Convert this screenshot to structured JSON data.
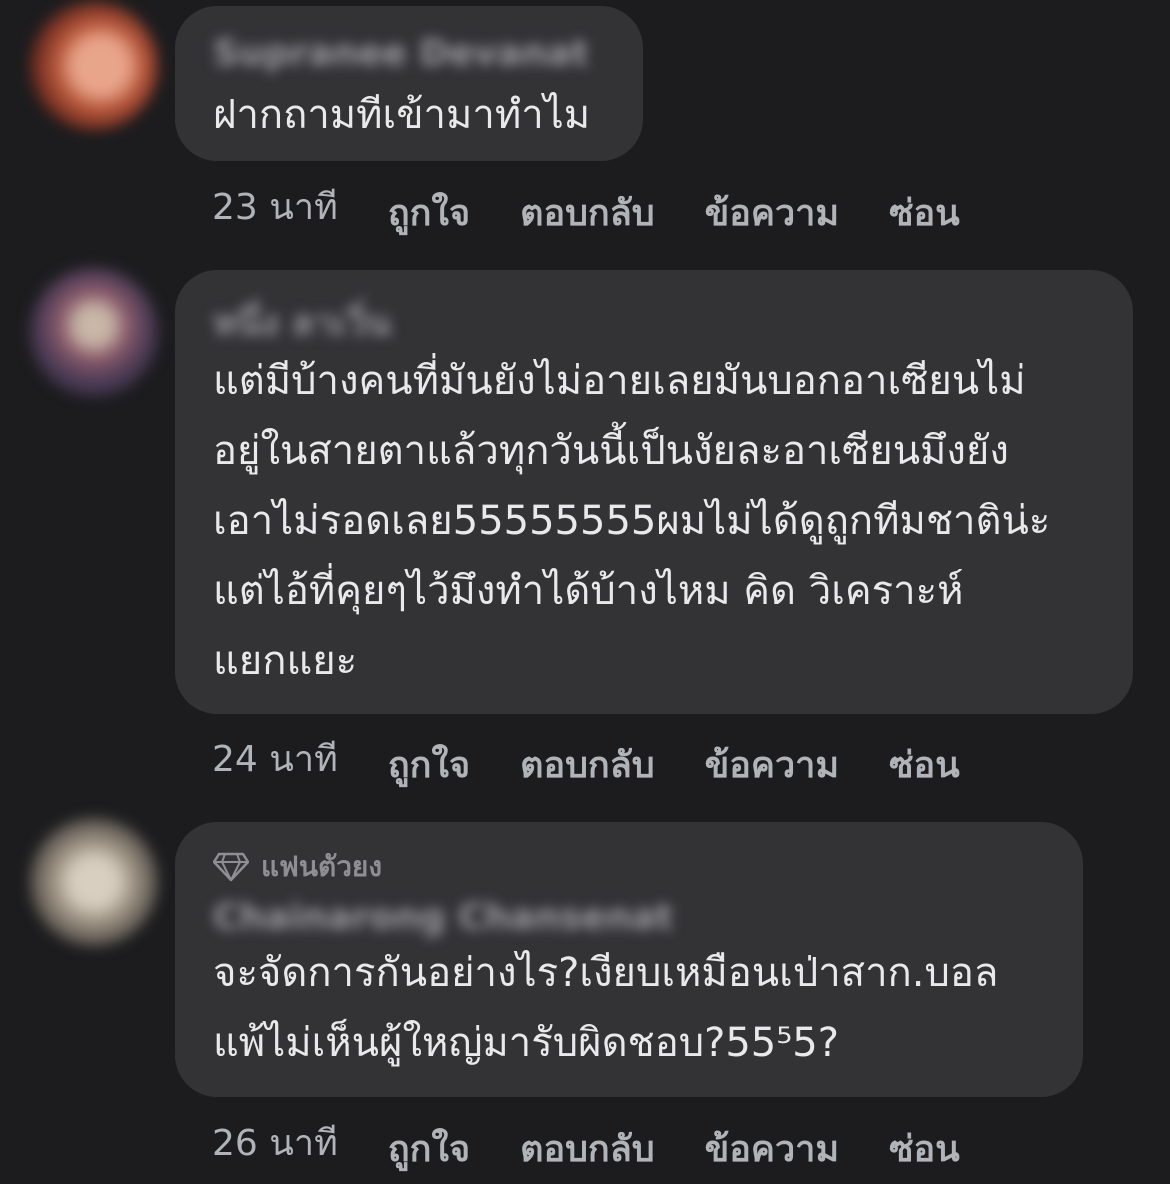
{
  "comments": [
    {
      "author": "Supranee Devanat",
      "text": "ฝากถามทีเข้ามาทำไม",
      "time": "23 นาที"
    },
    {
      "author": "หนึ่ง ลาเวิ่น",
      "text": "แต่มีบ้างคนที่มันยังไม่อายเลยมันบอกอาเซียนไม่\nอยู่ในสายตาแล้วทุกวันนี้เป็นงัยละอาเซียนมึงยัง\nเอาไม่รอดเลย55555555ผมไม่ได้ดูถูกทีมชาติน่ะ\nแต่ไอ้ที่คุยๆไว้มึงทำได้บ้างไหม คิด วิเคราะห์\nแยกแยะ",
      "time": "24 นาที"
    },
    {
      "badge": "แฟนตัวยง",
      "author": "Chainarong Chansenat",
      "text": "จะจัดการกันอย่างไร?เงียบเหมือนเป่าสาก.บอล\nแพ้ไม่เห็นผู้ใหญ่มารับผิดชอบ?55⁵5?",
      "time": "26 นาที"
    }
  ],
  "actions": {
    "like": "ถูกใจ",
    "reply": "ตอบกลับ",
    "message": "ข้อความ",
    "hide": "ซ่อน"
  },
  "colors": {
    "background": "#1c1c1e",
    "bubble": "#333336",
    "text": "#e9e9ec",
    "meta": "#b0b3b8"
  }
}
